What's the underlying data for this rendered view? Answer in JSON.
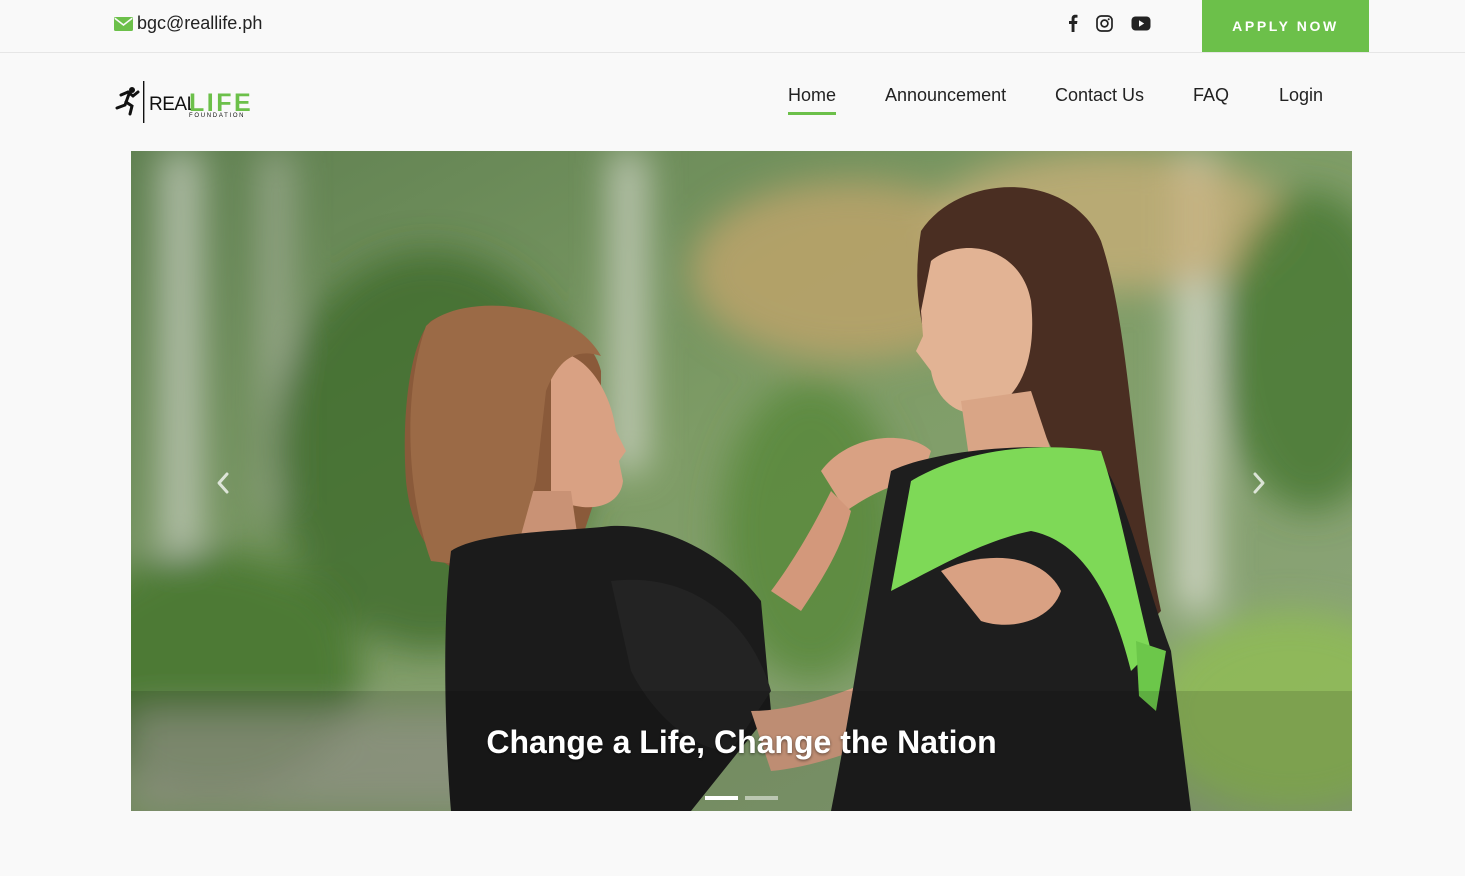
{
  "topbar": {
    "email": "bgc@reallife.ph",
    "email_icon": "envelope-icon",
    "socials": [
      {
        "name": "facebook",
        "icon": "facebook-icon"
      },
      {
        "name": "instagram",
        "icon": "instagram-icon"
      },
      {
        "name": "youtube",
        "icon": "youtube-icon"
      }
    ],
    "apply_label": "APPLY NOW"
  },
  "brand": {
    "logo_text_real": "REAL",
    "logo_text_life": "LIFE",
    "logo_subtext": "FOUNDATION"
  },
  "nav": {
    "items": [
      {
        "label": "Home",
        "active": true
      },
      {
        "label": "Announcement",
        "active": false
      },
      {
        "label": "Contact Us",
        "active": false
      },
      {
        "label": "FAQ",
        "active": false
      },
      {
        "label": "Login",
        "active": false
      }
    ]
  },
  "hero": {
    "caption": "Change a Life, Change the Nation",
    "prev_icon": "chevron-left-icon",
    "next_icon": "chevron-right-icon",
    "slide_count": 2,
    "active_slide": 1
  },
  "colors": {
    "accent": "#6cc04a",
    "text": "#222222",
    "background": "#f9f9f9"
  }
}
